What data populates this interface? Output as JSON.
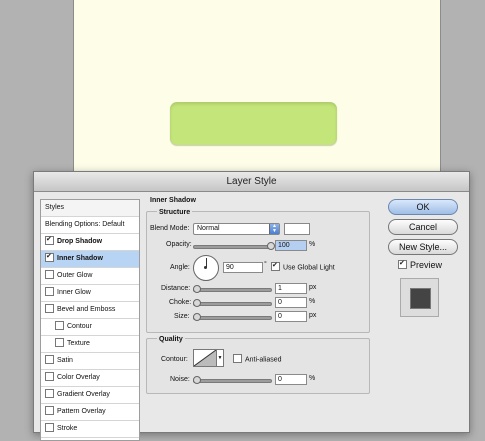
{
  "dialog": {
    "title": "Layer Style"
  },
  "styles_panel": {
    "header": "Styles",
    "items": [
      {
        "label": "Blending Options: Default",
        "checkbox": false,
        "checked": false,
        "bold": false,
        "selected": false,
        "indent": false
      },
      {
        "label": "Drop Shadow",
        "checkbox": true,
        "checked": true,
        "bold": true,
        "selected": false,
        "indent": false
      },
      {
        "label": "Inner Shadow",
        "checkbox": true,
        "checked": true,
        "bold": true,
        "selected": true,
        "indent": false
      },
      {
        "label": "Outer Glow",
        "checkbox": true,
        "checked": false,
        "bold": false,
        "selected": false,
        "indent": false
      },
      {
        "label": "Inner Glow",
        "checkbox": true,
        "checked": false,
        "bold": false,
        "selected": false,
        "indent": false
      },
      {
        "label": "Bevel and Emboss",
        "checkbox": true,
        "checked": false,
        "bold": false,
        "selected": false,
        "indent": false
      },
      {
        "label": "Contour",
        "checkbox": true,
        "checked": false,
        "bold": false,
        "selected": false,
        "indent": true
      },
      {
        "label": "Texture",
        "checkbox": true,
        "checked": false,
        "bold": false,
        "selected": false,
        "indent": true
      },
      {
        "label": "Satin",
        "checkbox": true,
        "checked": false,
        "bold": false,
        "selected": false,
        "indent": false
      },
      {
        "label": "Color Overlay",
        "checkbox": true,
        "checked": false,
        "bold": false,
        "selected": false,
        "indent": false
      },
      {
        "label": "Gradient Overlay",
        "checkbox": true,
        "checked": false,
        "bold": false,
        "selected": false,
        "indent": false
      },
      {
        "label": "Pattern Overlay",
        "checkbox": true,
        "checked": false,
        "bold": false,
        "selected": false,
        "indent": false
      },
      {
        "label": "Stroke",
        "checkbox": true,
        "checked": false,
        "bold": false,
        "selected": false,
        "indent": false
      }
    ]
  },
  "inner_shadow": {
    "title": "Inner Shadow",
    "structure": {
      "title": "Structure",
      "blend_mode_label": "Blend Mode:",
      "blend_mode_value": "Normal",
      "opacity_label": "Opacity:",
      "opacity_value": "100",
      "opacity_unit": "%",
      "angle_label": "Angle:",
      "angle_value": "90",
      "angle_unit": "°",
      "use_global_light_label": "Use Global Light",
      "use_global_light_checked": true,
      "distance_label": "Distance:",
      "distance_value": "1",
      "distance_unit": "px",
      "choke_label": "Choke:",
      "choke_value": "0",
      "choke_unit": "%",
      "size_label": "Size:",
      "size_value": "0",
      "size_unit": "px"
    },
    "quality": {
      "title": "Quality",
      "contour_label": "Contour:",
      "anti_aliased_label": "Anti-aliased",
      "anti_aliased_checked": false,
      "noise_label": "Noise:",
      "noise_value": "0",
      "noise_unit": "%"
    }
  },
  "buttons": {
    "ok": "OK",
    "cancel": "Cancel",
    "new_style": "New Style...",
    "preview_label": "Preview",
    "preview_checked": true
  },
  "colors": {
    "canvas_bg": "#fdfde8",
    "button_green": "#c4e57a",
    "selected_row": "#b7d4f5"
  }
}
